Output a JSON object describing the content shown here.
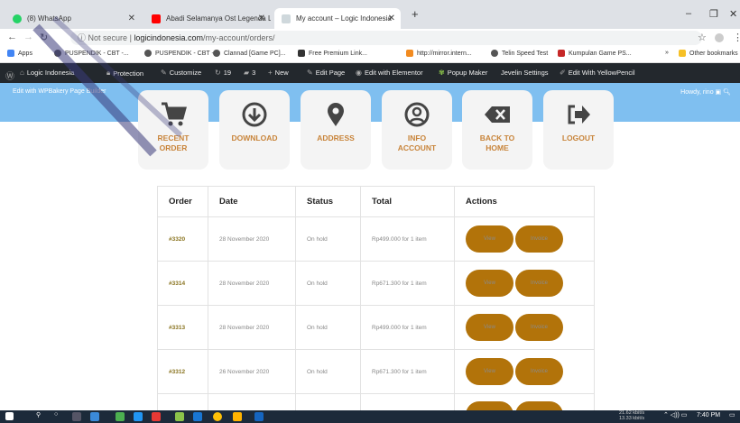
{
  "browser": {
    "tabs": [
      {
        "label": "(8) WhatsApp",
        "icon": "whatsapp-icon",
        "color": "#25d366"
      },
      {
        "label": "Abadi Selamanya Ost Legenda L",
        "icon": "youtube-icon",
        "color": "#ff0000"
      },
      {
        "label": "My account – Logic Indonesia",
        "icon": "site-icon",
        "color": "#9aa"
      }
    ],
    "new_tab": "+",
    "url_prefix": "Not secure",
    "url_host": "logicindonesia.com",
    "url_path": "/my-account/orders/",
    "bookmarks": [
      {
        "label": "Apps",
        "color": "#4285f4"
      },
      {
        "label": "PUSPENDIK - CBT -...",
        "color": "#666"
      },
      {
        "label": "PUSPENDIK - CBT -...",
        "color": "#666"
      },
      {
        "label": "Clannad [Game PC]...",
        "color": "#666"
      },
      {
        "label": "Free Premium Link...",
        "color": "#333"
      },
      {
        "label": "http://mirror.intern...",
        "color": "#f28b20"
      },
      {
        "label": "Telin Speed Test",
        "color": "#666"
      },
      {
        "label": "Kumpulan Game PS...",
        "color": "#c62828"
      }
    ],
    "other_bookmarks": "Other bookmarks",
    "overflow": "»"
  },
  "wpbar": {
    "items": [
      "Logic Indonesia",
      "Protection",
      "Customize",
      "19",
      "3",
      "New",
      "Edit Page",
      "Edit with Elementor",
      "Popup Maker",
      "Jevelin Settings",
      "Edit With YellowPencil"
    ]
  },
  "band": {
    "edit": "Edit with WPBakery Page Builder",
    "howdy": "Howdy, rino"
  },
  "nav": [
    {
      "label": "RECENT\nORDER",
      "icon": "cart-icon"
    },
    {
      "label": "DOWNLOAD",
      "icon": "download-icon"
    },
    {
      "label": "ADDRESS",
      "icon": "map-pin-icon"
    },
    {
      "label": "INFO\nACCOUNT",
      "icon": "user-icon"
    },
    {
      "label": "BACK TO\nHOME",
      "icon": "backspace-icon"
    },
    {
      "label": "LOGOUT",
      "icon": "logout-icon"
    }
  ],
  "table": {
    "headers": [
      "Order",
      "Date",
      "Status",
      "Total",
      "Actions"
    ],
    "rows": [
      {
        "order": "#3320",
        "date": "28 November 2020",
        "status": "On hold",
        "total": "Rp499.000 for 1 item"
      },
      {
        "order": "#3314",
        "date": "28 November 2020",
        "status": "On hold",
        "total": "Rp671.300 for 1 item"
      },
      {
        "order": "#3313",
        "date": "28 November 2020",
        "status": "On hold",
        "total": "Rp499.000 for 1 item"
      },
      {
        "order": "#3312",
        "date": "26 November 2020",
        "status": "On hold",
        "total": "Rp671.300 for 1 item"
      }
    ],
    "view_label": "View",
    "invoice_label": "Invoice"
  },
  "taskbar": {
    "net_up": "21.62 kbit/s",
    "net_down": "13.33 kbit/s",
    "time": "7:40 PM"
  }
}
